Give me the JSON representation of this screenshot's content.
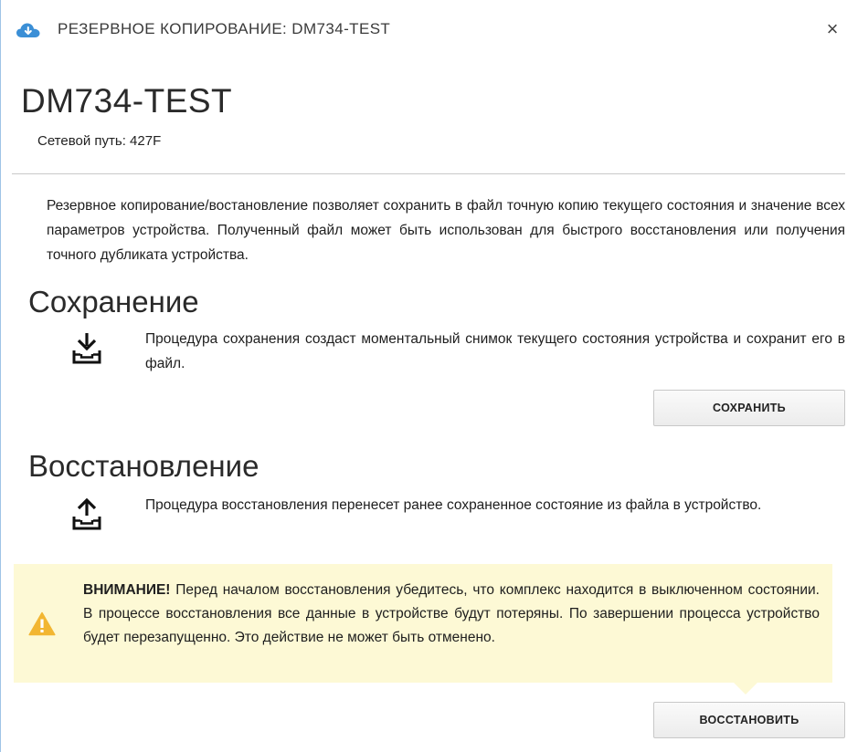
{
  "window": {
    "title": "РЕЗЕРВНОЕ КОПИРОВАНИЕ: DM734-TEST",
    "close_glyph": "×",
    "icon": "cloud-download-icon"
  },
  "device": {
    "name": "DM734-TEST",
    "network_path": "Сетевой путь: 427F"
  },
  "intro": "Резервное копирование/востановление позволяет сохранить в файл точную копию текущего состояния и значение всех параметров устройства. Полученный файл может быть использован для быстрого восстановления или получения точного дубликата устройства.",
  "save": {
    "title": "Сохранение",
    "icon": "download-tray-icon",
    "description": "Процедура сохранения создаст моментальный снимок текущего состояния устройства и сохранит его в файл.",
    "button_label": "СОХРАНИТЬ"
  },
  "restore": {
    "title": "Восстановление",
    "icon": "upload-tray-icon",
    "description": "Процедура восстановления перенесет ранее сохраненное состояние из файла в устройство.",
    "button_label": "ВОССТАНОВИТЬ"
  },
  "warning": {
    "icon": "warning-triangle-icon",
    "label": "ВНИМАНИЕ!",
    "text": " Перед началом восстановления убедитесь, что комплекс находится в выключенном состоянии. В процессе восстановления все данные в устройстве будут потеряны. По завершении процесса устройство будет перезапущенно. Это действие не может быть отменено."
  },
  "colors": {
    "accent": "#3b8fd6",
    "warning_bg": "#fdf9d5",
    "warning_icon": "#f2b632"
  }
}
